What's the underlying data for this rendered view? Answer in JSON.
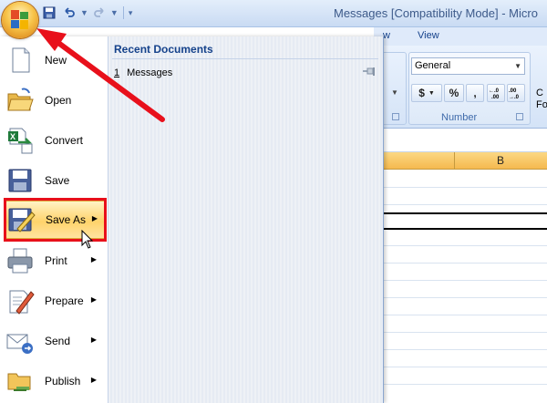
{
  "window": {
    "title": "Messages  [Compatibility Mode] - Micro"
  },
  "ribbon": {
    "tabs": [
      "w",
      "View"
    ],
    "number_format": "General",
    "group_label": "Number",
    "buttons": [
      "$",
      "%",
      ","
    ],
    "dec_increase": ".0→.00",
    "dec_decrease": ".00→.0",
    "right_fragment": "C\nFo"
  },
  "sheet": {
    "column_b": "B"
  },
  "menu": {
    "items": [
      {
        "label": "New",
        "icon": "new-document-icon"
      },
      {
        "label": "Open",
        "icon": "open-folder-icon"
      },
      {
        "label": "Convert",
        "icon": "convert-icon"
      },
      {
        "label": "Save",
        "icon": "save-icon"
      },
      {
        "label": "Save As",
        "icon": "save-as-icon"
      },
      {
        "label": "Print",
        "icon": "print-icon"
      },
      {
        "label": "Prepare",
        "icon": "prepare-icon"
      },
      {
        "label": "Send",
        "icon": "send-icon"
      },
      {
        "label": "Publish",
        "icon": "publish-icon"
      }
    ],
    "recent_title": "Recent Documents",
    "recent": [
      {
        "number": "1",
        "name": "Messages"
      }
    ]
  },
  "colors": {
    "highlight_red": "#e8101b",
    "selected_item": "#ffd36b"
  }
}
